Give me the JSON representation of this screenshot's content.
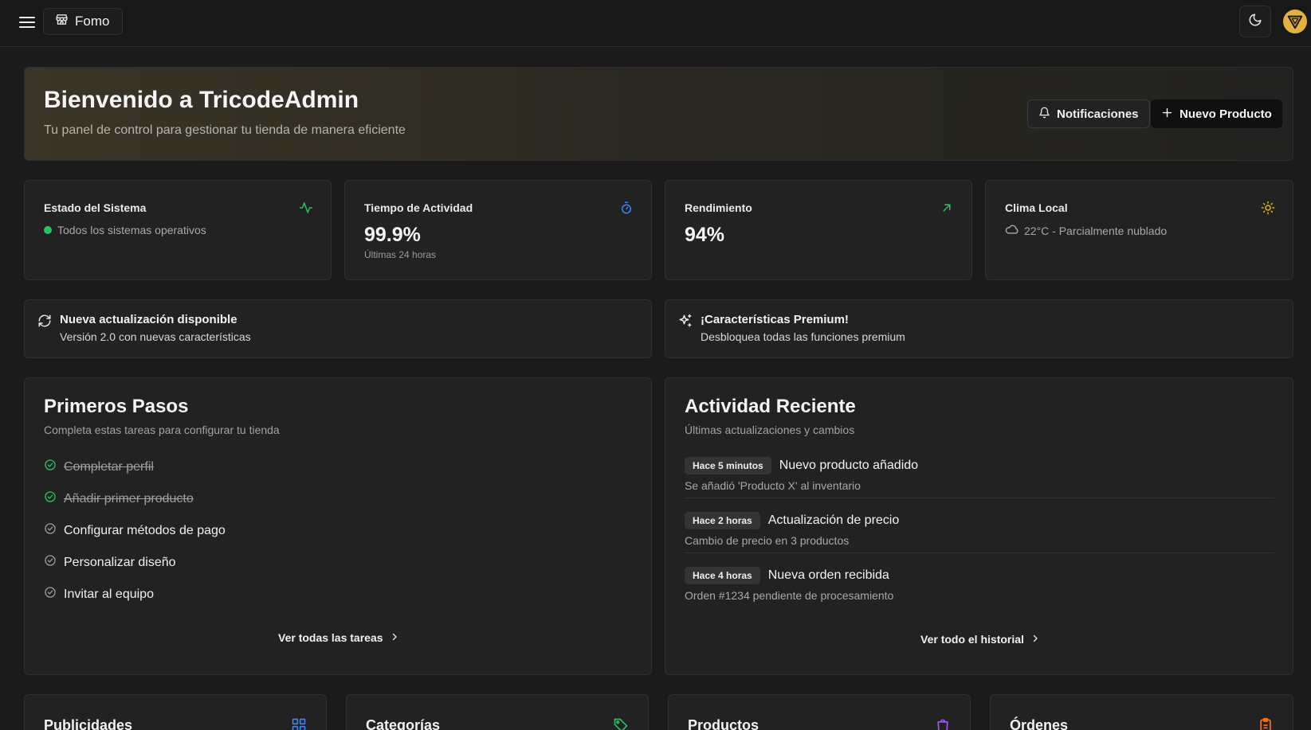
{
  "topbar": {
    "store_name": "Fomo",
    "icons": {
      "menu": "menu-icon",
      "store": "store-icon",
      "theme": "moon-icon",
      "avatar": "logo-avatar"
    }
  },
  "hero": {
    "title": "Bienvenido a TricodeAdmin",
    "subtitle": "Tu panel de control para gestionar tu tienda de manera eficiente",
    "notifications_label": "Notificaciones",
    "new_product_label": "Nuevo Producto"
  },
  "stats": [
    {
      "title": "Estado del Sistema",
      "status_text": "Todos los sistemas operativos",
      "icon": "activity-icon",
      "icon_color": "#22c55e"
    },
    {
      "title": "Tiempo de Actividad",
      "value": "99.9%",
      "note": "Últimas 24 horas",
      "icon": "timer-icon",
      "icon_color": "#3b82f6"
    },
    {
      "title": "Rendimiento",
      "value": "94%",
      "icon": "trend-up-icon",
      "icon_color": "#22c55e"
    },
    {
      "title": "Clima Local",
      "weather_text": "22°C - Parcialmente nublado",
      "icon": "sun-icon",
      "icon_color": "#eab308"
    }
  ],
  "banners": [
    {
      "title": "Nueva actualización disponible",
      "subtitle": "Versión 2.0 con nuevas características",
      "icon": "refresh-icon"
    },
    {
      "title": "¡Características Premium!",
      "subtitle": "Desbloquea todas las funciones premium",
      "icon": "sparkles-icon"
    }
  ],
  "getting_started": {
    "title": "Primeros Pasos",
    "subtitle": "Completa estas tareas para configurar tu tienda",
    "tasks": [
      {
        "label": "Completar perfil",
        "done": true
      },
      {
        "label": "Añadir primer producto",
        "done": true
      },
      {
        "label": "Configurar métodos de pago",
        "done": false
      },
      {
        "label": "Personalizar diseño",
        "done": false
      },
      {
        "label": "Invitar al equipo",
        "done": false
      }
    ],
    "link_label": "Ver todas las tareas"
  },
  "recent_activity": {
    "title": "Actividad Reciente",
    "subtitle": "Últimas actualizaciones y cambios",
    "items": [
      {
        "time": "Hace 5 minutos",
        "title": "Nuevo producto añadido",
        "desc": "Se añadió 'Producto X' al inventario"
      },
      {
        "time": "Hace 2 horas",
        "title": "Actualización de precio",
        "desc": "Cambio de precio en 3 productos"
      },
      {
        "time": "Hace 4 horas",
        "title": "Nueva orden recibida",
        "desc": "Orden #1234 pendiente de procesamiento"
      }
    ],
    "link_label": "Ver todo el historial"
  },
  "bottom_cards": [
    {
      "title": "Publicidades",
      "icon": "grid-icon",
      "icon_color": "#3b82f6"
    },
    {
      "title": "Categorías",
      "icon": "tags-icon",
      "icon_color": "#22c55e"
    },
    {
      "title": "Productos",
      "icon": "shopping-bag-icon",
      "icon_color": "#a855f7"
    },
    {
      "title": "Órdenes",
      "icon": "clipboard-icon",
      "icon_color": "#f97316"
    }
  ]
}
